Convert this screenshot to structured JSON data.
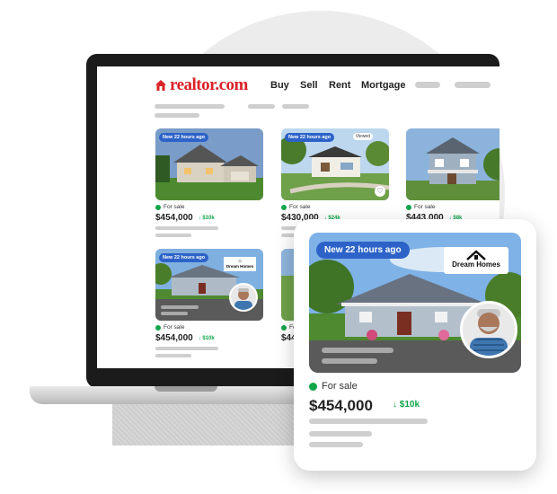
{
  "header": {
    "logo": "realtor.com",
    "nav": [
      "Buy",
      "Sell",
      "Rent",
      "Mortgage"
    ]
  },
  "listings": [
    {
      "badge": "New 22 hours ago",
      "status": "For sale",
      "price": "$454,000",
      "drop": "↓ $10k"
    },
    {
      "badge": "New 22 hours ago",
      "viewed": "Viewed",
      "status": "For sale",
      "price": "$430,000",
      "drop": "↓ $24k"
    },
    {
      "badge": "",
      "status": "For sale",
      "price": "$443,000",
      "drop": "↓ $8k"
    },
    {
      "badge": "New 22 hours ago",
      "brand": "Dream Homes",
      "status": "For sale",
      "price": "$454,000",
      "drop": "↓ $10k"
    },
    {
      "badge": "",
      "status": "For sale",
      "price": "$44",
      "drop": ""
    }
  ],
  "popup": {
    "badge": "New 22 hours ago",
    "brand": "Dream Homes",
    "status": "For sale",
    "price": "$454,000",
    "drop": "↓ $10k"
  },
  "colors": {
    "brand": "#d92228",
    "badge": "#2d63c8",
    "status": "#10a64a"
  }
}
